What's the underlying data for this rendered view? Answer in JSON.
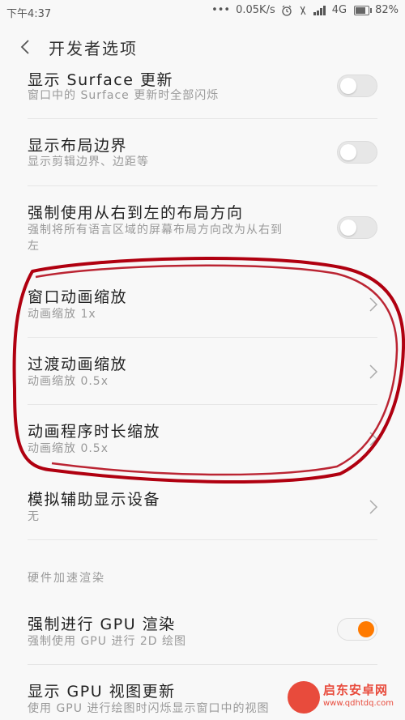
{
  "status_bar": {
    "time": "下午4:37",
    "network_speed": "0.05K/s",
    "network_type": "4G",
    "battery": "82%",
    "battery_level": 0.82
  },
  "header": {
    "title": "开发者选项",
    "back_icon": "chevron-left-icon"
  },
  "rows": {
    "surface": {
      "title": "显示 Surface 更新",
      "subtitle": "窗口中的 Surface 更新时全部闪烁",
      "toggle": false
    },
    "layout_bounds": {
      "title": "显示布局边界",
      "subtitle": "显示剪辑边界、边距等",
      "toggle": false
    },
    "rtl": {
      "title": "强制使用从右到左的布局方向",
      "subtitle_line1": "强制将所有语言区域的屏幕布局方向改为从右到",
      "subtitle_line2": "左",
      "toggle": false
    },
    "window_anim": {
      "title": "窗口动画缩放",
      "subtitle": "动画缩放 1x"
    },
    "transition_anim": {
      "title": "过渡动画缩放",
      "subtitle": "动画缩放 0.5x"
    },
    "animator_duration": {
      "title": "动画程序时长缩放",
      "subtitle": "动画缩放 0.5x"
    },
    "secondary_display": {
      "title": "模拟辅助显示设备",
      "subtitle": "无"
    },
    "force_gpu": {
      "title": "强制进行 GPU 渲染",
      "subtitle": "强制使用 GPU 进行 2D 绘图",
      "toggle": true
    },
    "gpu_view_updates": {
      "title": "显示 GPU 视图更新",
      "subtitle": "使用 GPU 进行绘图时闪烁显示窗口中的视图"
    }
  },
  "section": {
    "hardware_accel": "硬件加速渲染"
  },
  "watermark": {
    "name": "启东安卓网",
    "url": "www.qdhtdq.com"
  },
  "colors": {
    "accent": "#ff7a00",
    "annotation": "#b00010"
  }
}
